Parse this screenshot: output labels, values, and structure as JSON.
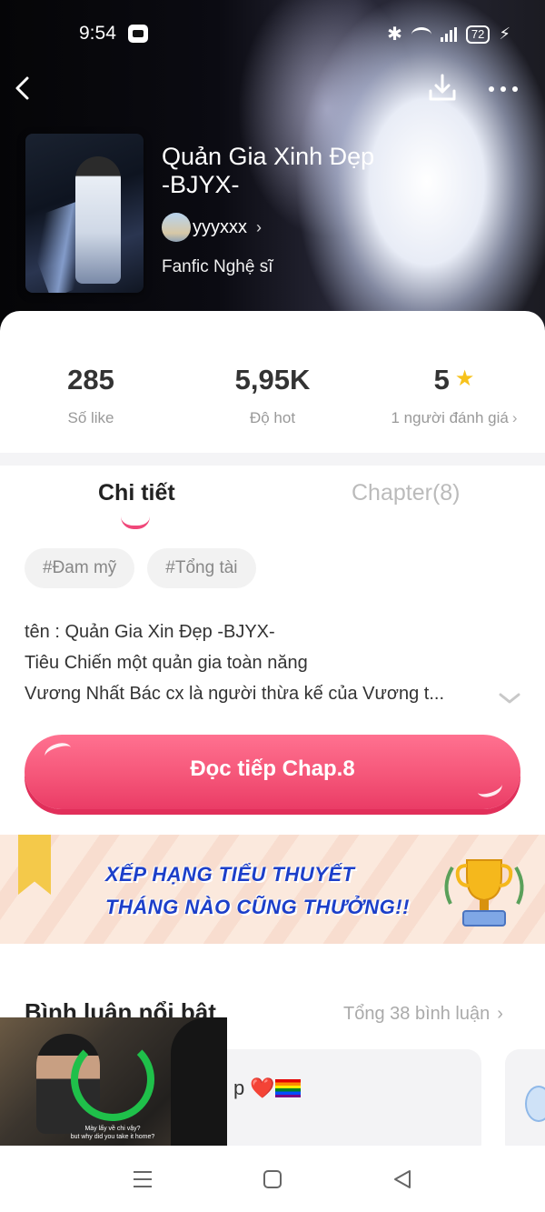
{
  "status_bar": {
    "time": "9:54",
    "battery": "72"
  },
  "header": {
    "title_line1": "Quản Gia Xinh Đẹp",
    "title_line2": "-BJYX-",
    "author": "yyyxxx",
    "genre": "Fanfic Nghệ sĩ"
  },
  "stats": {
    "likes_value": "285",
    "likes_label": "Số like",
    "hot_value": "5,95K",
    "hot_label": "Độ hot",
    "rating_value": "5",
    "rating_label": "1 người đánh giá"
  },
  "tabs": {
    "detail": "Chi tiết",
    "chapter": "Chapter(8)"
  },
  "tags": [
    "#Đam mỹ",
    "#Tổng tài"
  ],
  "description": {
    "line1": "tên : Quản Gia Xin Đẹp -BJYX-",
    "line2": "Tiêu Chiến một quản gia toàn năng",
    "line3": "Vương Nhất Bác cx là người thừa kế của Vương t..."
  },
  "read_button": "Đọc tiếp Chap.8",
  "banner": {
    "line1": "XẾP HẠNG TIỂU THUYẾT",
    "line2": "THÁNG NÀO CŨNG THƯỞNG!!"
  },
  "comments": {
    "title": "Bình luận nổi bật",
    "total": "Tổng 38 bình luận",
    "snippet": "p ❤️"
  },
  "pip": {
    "subtitle_line1": "Mày lấy về chi vậy?",
    "subtitle_line2": "but why did you take it home?"
  },
  "colors": {
    "accent": "#f55679",
    "star": "#f7c21b",
    "banner_text": "#1c3fc9"
  }
}
